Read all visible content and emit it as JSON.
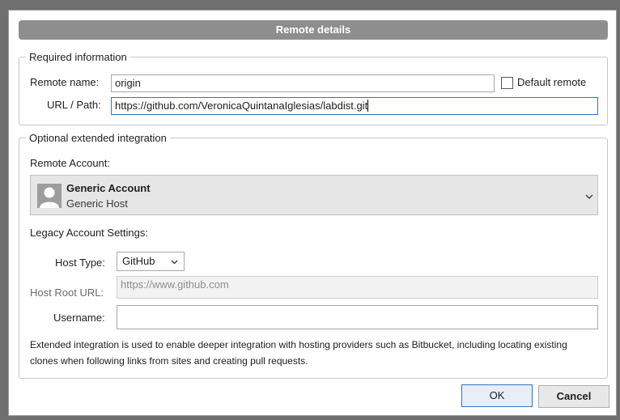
{
  "dialog": {
    "title": "Remote details"
  },
  "required": {
    "legend": "Required information",
    "remote_name_label": "Remote name:",
    "remote_name_value": "origin",
    "default_remote_label": "Default remote",
    "default_remote_checked": false,
    "url_label": "URL / Path:",
    "url_value": "https://github.com/VeronicaQuintanaIglesias/labdist.git"
  },
  "optional": {
    "legend": "Optional extended integration",
    "remote_account_label": "Remote Account:",
    "account_name": "Generic Account",
    "account_host": "Generic Host",
    "legacy_label": "Legacy Account Settings:",
    "host_type_label": "Host Type:",
    "host_type_value": "GitHub",
    "host_root_label": "Host Root URL:",
    "host_root_placeholder": "https://www.github.com",
    "username_label": "Username:",
    "username_value": "",
    "help_text": "Extended integration is used to enable deeper integration with hosting providers such as Bitbucket, including locating existing clones when following links from sites and creating pull requests."
  },
  "buttons": {
    "ok_label": "OK",
    "cancel_label": "Cancel"
  },
  "colors": {
    "titlebar": "#8e8e8e",
    "focus_accent": "#2e75c8",
    "account_background": "#e6e6e6"
  }
}
